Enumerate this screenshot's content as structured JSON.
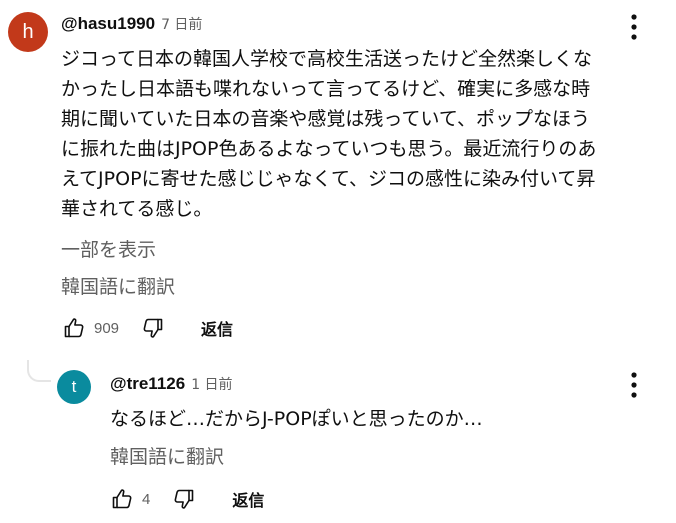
{
  "comment": {
    "avatar_letter": "h",
    "avatar_color": "#c2391a",
    "author": "@hasu1990",
    "time": "7 日前",
    "lines": [
      "ジコって日本の韓国人学校で高校生活送ったけど全然楽しくな",
      "かったし日本語も喋れないって言ってるけど、確実に多感な時",
      "期に聞いていた日本の音楽や感覚は残っていて、ポップなほう",
      "に振れた曲はJPOP色あるよなっていつも思う。最近流行りのあ",
      "えてJPOPに寄せた感じじゃなくて、ジコの感性に染み付いて昇",
      "華されてる感じ。"
    ],
    "read_more": "一部を表示",
    "translate": "韓国語に翻訳",
    "like_count": "909",
    "reply_label": "返信"
  },
  "reply": {
    "avatar_letter": "t",
    "avatar_color": "#0a8b9e",
    "author": "@tre1126",
    "time": "1 日前",
    "text": "なるほど…だからJ-POPぽいと思ったのか…",
    "translate": "韓国語に翻訳",
    "like_count": "4",
    "reply_label": "返信"
  },
  "icons": [
    "thumb-up-icon",
    "thumb-down-icon",
    "more-vert-icon"
  ]
}
